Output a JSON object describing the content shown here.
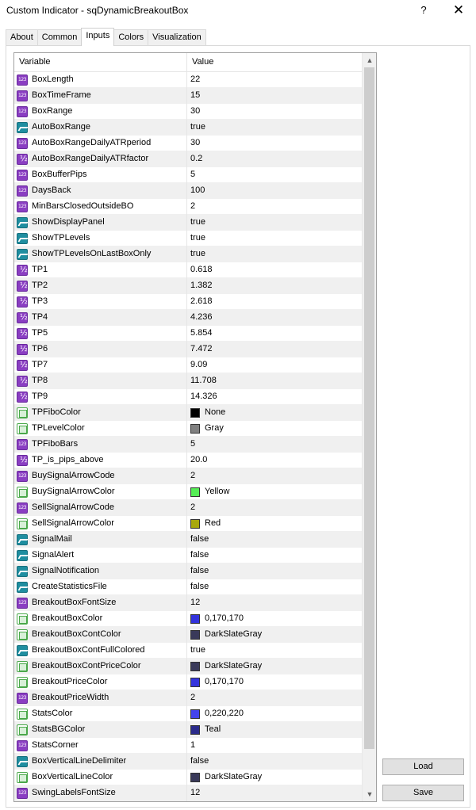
{
  "window": {
    "title": "Custom Indicator - sqDynamicBreakoutBox",
    "help_label": "?",
    "close_label": "✕"
  },
  "tabs": [
    {
      "label": "About"
    },
    {
      "label": "Common"
    },
    {
      "label": "Inputs"
    },
    {
      "label": "Colors"
    },
    {
      "label": "Visualization"
    }
  ],
  "active_tab": "Inputs",
  "grid": {
    "header_variable": "Variable",
    "header_value": "Value"
  },
  "params": [
    {
      "type": "int",
      "name": "BoxLength",
      "value": "22"
    },
    {
      "type": "int",
      "name": "BoxTimeFrame",
      "value": "15"
    },
    {
      "type": "int",
      "name": "BoxRange",
      "value": "30"
    },
    {
      "type": "bool",
      "name": "AutoBoxRange",
      "value": "true"
    },
    {
      "type": "int",
      "name": "AutoBoxRangeDailyATRperiod",
      "value": "30"
    },
    {
      "type": "dbl",
      "name": "AutoBoxRangeDailyATRfactor",
      "value": "0.2"
    },
    {
      "type": "int",
      "name": "BoxBufferPips",
      "value": "5"
    },
    {
      "type": "int",
      "name": "DaysBack",
      "value": "100"
    },
    {
      "type": "int",
      "name": "MinBarsClosedOutsideBO",
      "value": "2"
    },
    {
      "type": "bool",
      "name": "ShowDisplayPanel",
      "value": "true"
    },
    {
      "type": "bool",
      "name": "ShowTPLevels",
      "value": "true"
    },
    {
      "type": "bool",
      "name": "ShowTPLevelsOnLastBoxOnly",
      "value": "true"
    },
    {
      "type": "dbl",
      "name": "TP1",
      "value": "0.618"
    },
    {
      "type": "dbl",
      "name": "TP2",
      "value": "1.382"
    },
    {
      "type": "dbl",
      "name": "TP3",
      "value": "2.618"
    },
    {
      "type": "dbl",
      "name": "TP4",
      "value": "4.236"
    },
    {
      "type": "dbl",
      "name": "TP5",
      "value": "5.854"
    },
    {
      "type": "dbl",
      "name": "TP6",
      "value": "7.472"
    },
    {
      "type": "dbl",
      "name": "TP7",
      "value": "9.09"
    },
    {
      "type": "dbl",
      "name": "TP8",
      "value": "11.708"
    },
    {
      "type": "dbl",
      "name": "TP9",
      "value": "14.326"
    },
    {
      "type": "color",
      "name": "TPFiboColor",
      "value": "None",
      "swatch": "#000000"
    },
    {
      "type": "color",
      "name": "TPLevelColor",
      "value": "Gray",
      "swatch": "#808080"
    },
    {
      "type": "int",
      "name": "TPFiboBars",
      "value": "5"
    },
    {
      "type": "dbl",
      "name": "TP_is_pips_above",
      "value": "20.0"
    },
    {
      "type": "int",
      "name": "BuySignalArrowCode",
      "value": "2"
    },
    {
      "type": "color",
      "name": "BuySignalArrowColor",
      "value": "Yellow",
      "swatch": "#55ee55"
    },
    {
      "type": "int",
      "name": "SellSignalArrowCode",
      "value": "2"
    },
    {
      "type": "color",
      "name": "SellSignalArrowColor",
      "value": "Red",
      "swatch": "#a8a80e"
    },
    {
      "type": "bool",
      "name": "SignalMail",
      "value": "false"
    },
    {
      "type": "bool",
      "name": "SignalAlert",
      "value": "false"
    },
    {
      "type": "bool",
      "name": "SignalNotification",
      "value": "false"
    },
    {
      "type": "bool",
      "name": "CreateStatisticsFile",
      "value": "false"
    },
    {
      "type": "int",
      "name": "BreakoutBoxFontSize",
      "value": "12"
    },
    {
      "type": "color",
      "name": "BreakoutBoxColor",
      "value": "0,170,170",
      "swatch": "#3333dd"
    },
    {
      "type": "color",
      "name": "BreakoutBoxContColor",
      "value": "DarkSlateGray",
      "swatch": "#3a3a5a"
    },
    {
      "type": "bool",
      "name": "BreakoutBoxContFullColored",
      "value": "true"
    },
    {
      "type": "color",
      "name": "BreakoutBoxContPriceColor",
      "value": "DarkSlateGray",
      "swatch": "#3a3a5a"
    },
    {
      "type": "color",
      "name": "BreakoutPriceColor",
      "value": "0,170,170",
      "swatch": "#3333dd"
    },
    {
      "type": "int",
      "name": "BreakoutPriceWidth",
      "value": "2"
    },
    {
      "type": "color",
      "name": "StatsColor",
      "value": "0,220,220",
      "swatch": "#4444ee"
    },
    {
      "type": "color",
      "name": "StatsBGColor",
      "value": "Teal",
      "swatch": "#2a2a8a"
    },
    {
      "type": "int",
      "name": "StatsCorner",
      "value": "1"
    },
    {
      "type": "bool",
      "name": "BoxVerticalLineDelimiter",
      "value": "false"
    },
    {
      "type": "color",
      "name": "BoxVerticalLineColor",
      "value": "DarkSlateGray",
      "swatch": "#3a3a5a"
    },
    {
      "type": "int",
      "name": "SwingLabelsFontSize",
      "value": "12"
    }
  ],
  "buttons": {
    "load": "Load",
    "save": "Save"
  },
  "scroll_arrows": {
    "up": "▲",
    "down": "▼"
  }
}
